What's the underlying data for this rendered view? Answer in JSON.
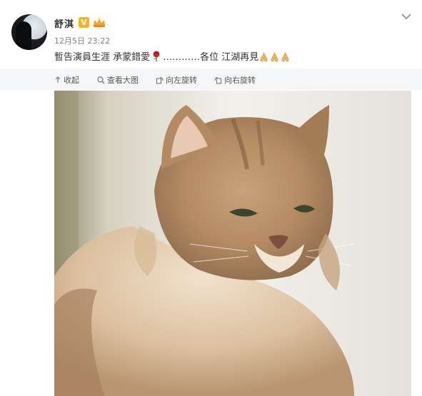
{
  "post": {
    "author": "舒淇",
    "timestamp": "12月5日 23:22",
    "text_part1": "暫告演員生涯  承蒙錯愛",
    "text_part2": "…………各位 江湖再見",
    "avatar_icon": "avatar-silhouette",
    "verified_label": "V"
  },
  "toolbar": {
    "collapse_label": "收起",
    "view_large_label": "查看大图",
    "rotate_left_label": "向左旋转",
    "rotate_right_label": "向右旋转"
  },
  "colors": {
    "verified_badge": "#f6b31b",
    "username": "#333333",
    "toolbar_bg": "#f5f6f7"
  },
  "icons": [
    "chevron-down-icon",
    "verified-icon",
    "vip-icon",
    "rose-icon",
    "pray-icon",
    "collapse-arrow-icon",
    "magnifier-icon",
    "rotate-left-icon",
    "rotate-right-icon"
  ],
  "photo": {
    "subject": "fluffy cat"
  }
}
